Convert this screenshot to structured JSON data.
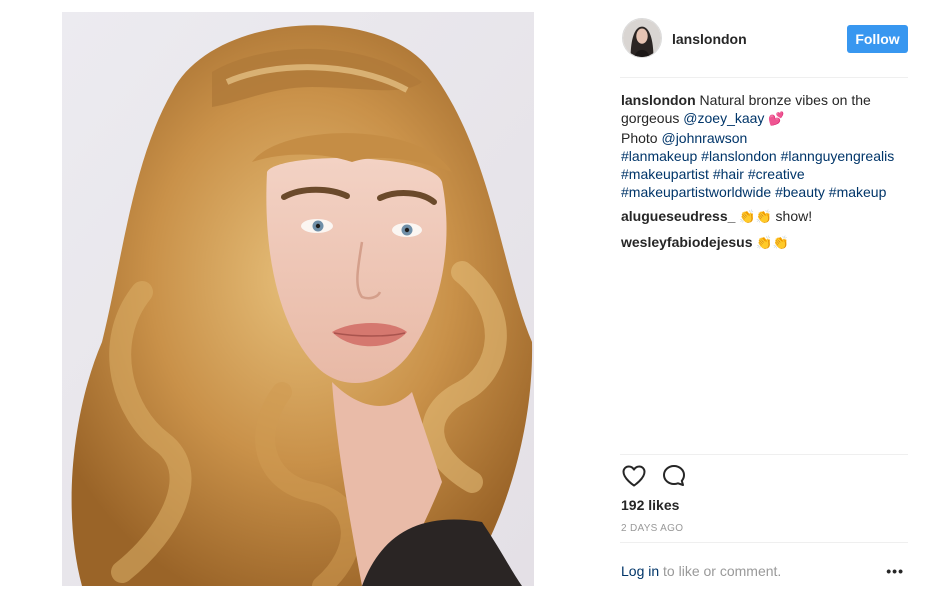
{
  "post": {
    "username": "lanslondon",
    "follow_label": "Follow",
    "caption": {
      "username": "lanslondon",
      "text_1": " Natural bronze vibes on the gorgeous ",
      "mention_1": "@zoey_kaay",
      "emoji_1": "💕",
      "text_2": "Photo ",
      "mention_2": "@johnrawson",
      "hashtags_line1": "#lanmakeup #lanslondon #lannguyengrealis",
      "hashtags_line2": "#makeupartist #hair #creative",
      "hashtags_line3": "#makeupartistworldwide #beauty #makeup"
    },
    "comments": [
      {
        "username": "alugueseudress_",
        "emoji": "👏👏",
        "text": " show!"
      },
      {
        "username": "wesleyfabiodejesus",
        "emoji": "👏👏",
        "text": ""
      }
    ],
    "likes": "192 likes",
    "timestamp": "2 DAYS AGO",
    "login_link": "Log in",
    "login_suffix": " to like or comment.",
    "more_label": "•••"
  },
  "icons": {
    "like": "heart-outline-icon",
    "comment": "speech-bubble-icon",
    "more": "ellipsis-icon"
  },
  "colors": {
    "follow_button": "#3897f0",
    "link": "#003569",
    "muted": "#999999"
  }
}
